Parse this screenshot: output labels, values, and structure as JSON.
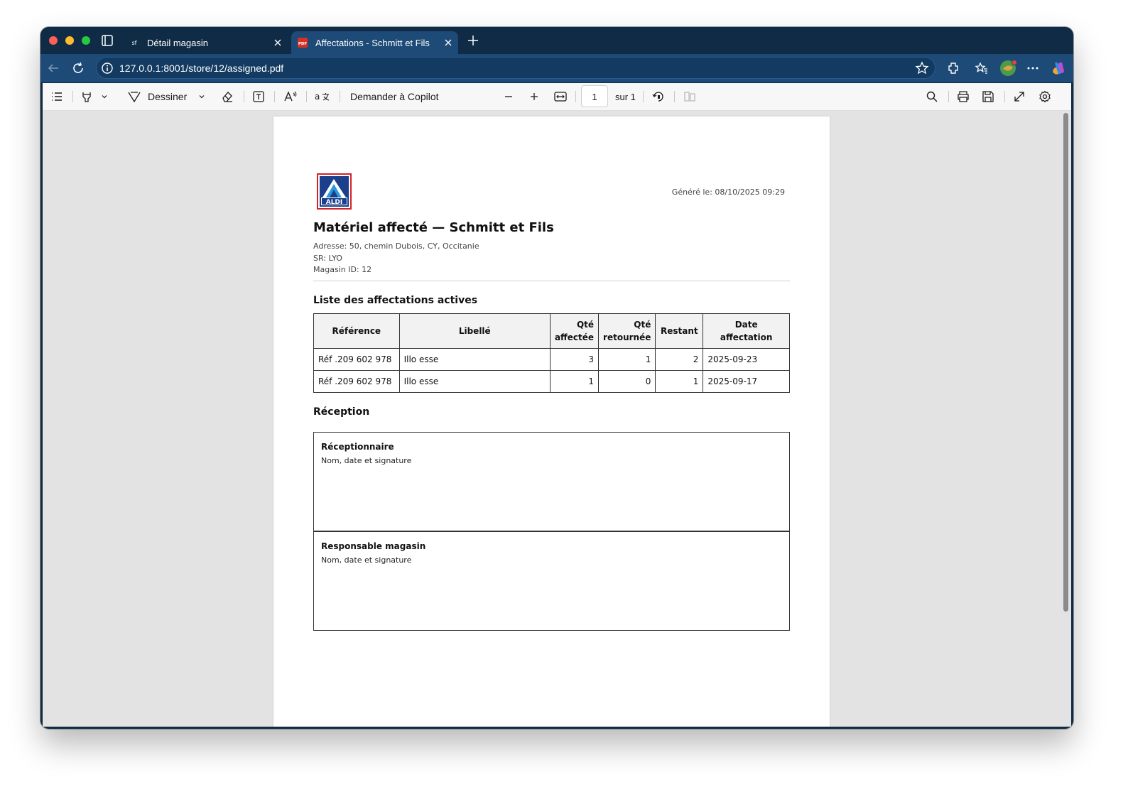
{
  "browser": {
    "tabs": [
      {
        "title": "Détail magasin",
        "active": false,
        "favicon_text": "sf"
      },
      {
        "title": "Affectations - Schmitt et Fils",
        "active": true,
        "favicon_text": "PDF"
      }
    ],
    "url": "127.0.0.1:8001/store/12/assigned.pdf"
  },
  "pdf_toolbar": {
    "draw_label": "Dessiner",
    "copilot_label": "Demander à Copilot",
    "page_current": "1",
    "page_total_label": "sur 1"
  },
  "document": {
    "logo_text": "ALDI",
    "generated": "Généré le: 08/10/2025 09:29",
    "title": "Matériel affecté — Schmitt et Fils",
    "address": "Adresse: 50, chemin Dubois, CY, Occitanie",
    "sr": "SR: LYO",
    "store_id": "Magasin ID: 12",
    "section_assignments": "Liste des affectations actives",
    "table": {
      "headers": {
        "reference": "Référence",
        "label": "Libellé",
        "qty_assigned_1": "Qté",
        "qty_assigned_2": "affectée",
        "qty_returned_1": "Qté",
        "qty_returned_2": "retournée",
        "remaining": "Restant",
        "date_1": "Date",
        "date_2": "affectation"
      },
      "rows": [
        {
          "reference": "Réf .209 602 978",
          "label": "Illo esse",
          "qty_assigned": "3",
          "qty_returned": "1",
          "remaining": "2",
          "date": "2025-09-23"
        },
        {
          "reference": "Réf .209 602 978",
          "label": "Illo esse",
          "qty_assigned": "1",
          "qty_returned": "0",
          "remaining": "1",
          "date": "2025-09-17"
        }
      ]
    },
    "section_reception": "Réception",
    "signatures": [
      {
        "title": "Réceptionnaire",
        "hint": "Nom, date et signature"
      },
      {
        "title": "Responsable magasin",
        "hint": "Nom, date et signature"
      }
    ]
  },
  "colors": {
    "titlebar": "#0f2b46",
    "toolbar": "#1d4a76",
    "viewer_bg": "#e3e3e3",
    "logo_blue": "#1e6bb8",
    "logo_red": "#d2232a"
  }
}
